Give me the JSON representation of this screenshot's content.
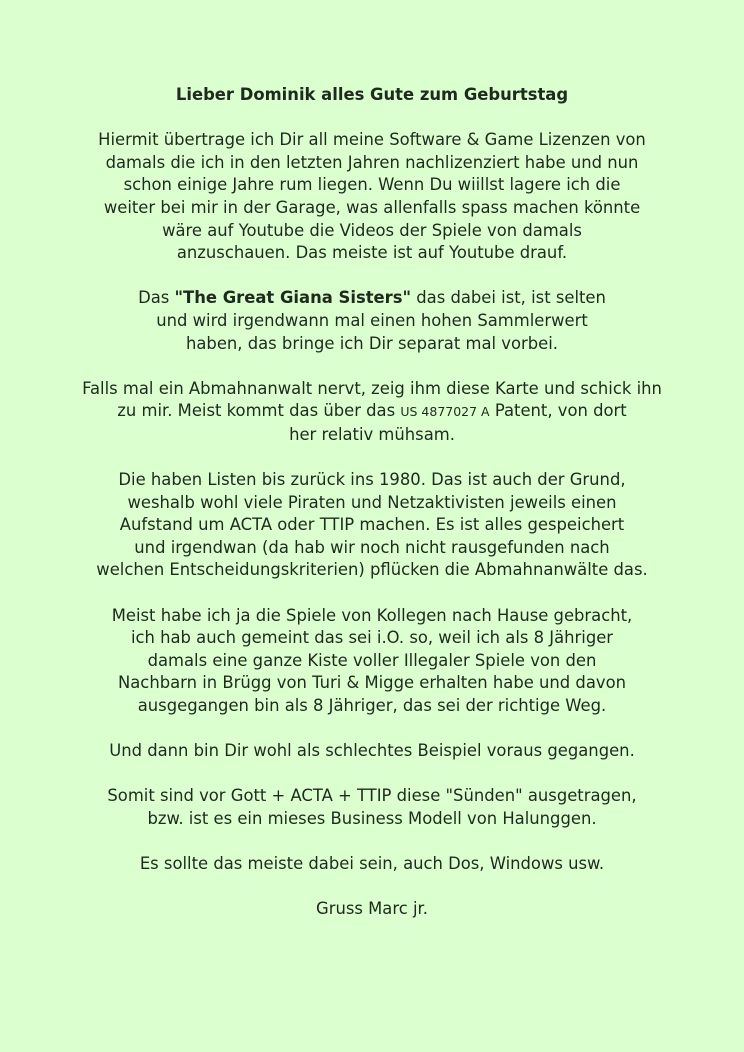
{
  "letter": {
    "greeting": "Lieber Dominik alles Gute zum Geburtstag",
    "p1": [
      "Hiermit übertrage ich Dir all meine Software & Game Lizenzen von",
      "damals die ich in den letzten Jahren nachlizenziert habe und nun",
      "schon einige Jahre rum liegen. Wenn Du wiillst lagere ich die",
      "weiter bei mir in der Garage, was allenfalls spass machen könnte",
      "wäre auf Youtube die Videos der Spiele von damals",
      "anzuschauen. Das meiste ist auf Youtube drauf."
    ],
    "p2": {
      "line1_pre": "Das ",
      "line1_bold": "\"The Great Giana Sisters\"",
      "line1_post": " das dabei ist, ist selten",
      "line2": "und wird irgendwann mal einen hohen Sammlerwert",
      "line3": "haben, das bringe ich Dir separat mal vorbei."
    },
    "p3": {
      "line1": "Falls mal ein Abmahnanwalt nervt, zeig ihm diese Karte und schick ihn",
      "line2_pre": "zu mir. Meist kommt das über das ",
      "line2_small": "US 4877027 A",
      "line2_post": " Patent, von dort",
      "line3": "her relativ mühsam."
    },
    "p4": [
      "Die haben Listen bis zurück ins 1980. Das ist auch der Grund,",
      "weshalb wohl viele Piraten und Netzaktivisten jeweils einen",
      "Aufstand um ACTA oder TTIP machen. Es ist alles gespeichert",
      "und irgendwan (da hab wir noch nicht rausgefunden nach",
      "welchen Entscheidungskriterien) pflücken die Abmahnanwälte das."
    ],
    "p5": [
      "Meist habe ich ja die Spiele von Kollegen nach Hause gebracht,",
      "ich hab auch gemeint das sei i.O. so, weil ich als 8 Jähriger",
      "damals eine ganze Kiste voller Illegaler Spiele von den",
      "Nachbarn in Brügg von Turi & Migge erhalten habe und davon",
      "ausgegangen bin als 8 Jähriger, das sei der richtige Weg."
    ],
    "p6": "Und dann bin Dir wohl als schlechtes Beispiel voraus gegangen.",
    "p7": [
      "Somit sind vor Gott + ACTA + TTIP diese \"Sünden\" ausgetragen,",
      "bzw. ist es ein mieses Business Modell von Halunggen."
    ],
    "p8": "Es sollte das meiste dabei sein, auch Dos, Windows usw.",
    "signature": "Gruss Marc jr."
  }
}
